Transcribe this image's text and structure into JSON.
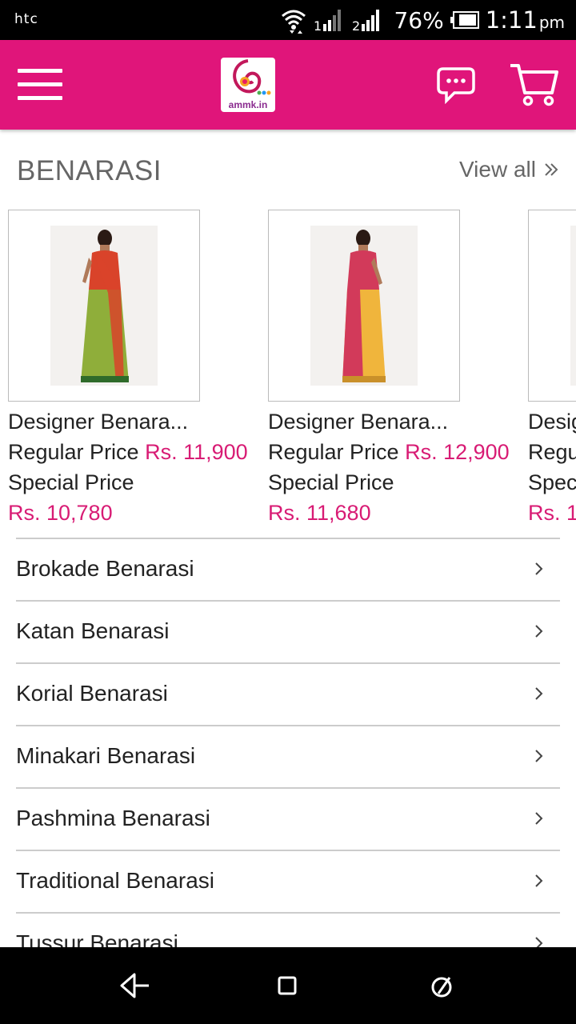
{
  "status_bar": {
    "brand": "htc",
    "battery": "76%",
    "time": "1:11",
    "ampm": "pm"
  },
  "app_bar": {
    "logo_text": "ammk.in",
    "icons": [
      "menu-icon",
      "chat-icon",
      "cart-icon"
    ]
  },
  "section": {
    "title": "BENARASI",
    "view_all": "View all"
  },
  "products": [
    {
      "name": "Designer Benara...",
      "regular_label": "Regular Price",
      "regular_price": "Rs. 11,900",
      "special_label": "Special Price",
      "special_price": "Rs. 10,780",
      "saree_colors": [
        "#d9432a",
        "#8fae3a"
      ]
    },
    {
      "name": "Designer Benara...",
      "regular_label": "Regular Price",
      "regular_price": "Rs. 12,900",
      "special_label": "Special Price",
      "special_price": "Rs. 11,680",
      "saree_colors": [
        "#d23a5a",
        "#f0b53c"
      ]
    },
    {
      "name": "Desig",
      "regular_label": "Regu",
      "regular_price": "",
      "special_label": "Spec",
      "special_price": "Rs. 1",
      "saree_colors": [
        "#e9d2c0",
        "#e9d2c0"
      ]
    }
  ],
  "categories": [
    "Brokade Benarasi",
    "Katan Benarasi",
    "Korial Benarasi",
    "Minakari Benarasi",
    "Pashmina Benarasi",
    "Traditional Benarasi",
    "Tussur Benarasi"
  ],
  "colors": {
    "accent": "#e0157a",
    "price": "#d81b74"
  },
  "nav_bar": {
    "icons": [
      "back-icon",
      "home-icon",
      "recents-icon"
    ]
  }
}
